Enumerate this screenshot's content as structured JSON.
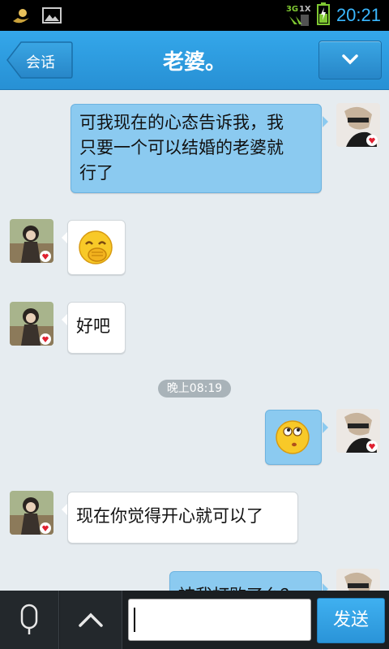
{
  "status_bar": {
    "time": "20:21",
    "network_left": "3G",
    "network_right": "1X",
    "icons": [
      "notification-app-icon",
      "image-icon",
      "signal-icon",
      "battery-charging-icon"
    ]
  },
  "header": {
    "back_label": "会话",
    "title": "老婆。",
    "menu_icon": "chevron-down-icon"
  },
  "messages": [
    {
      "direction": "outgoing",
      "type": "text",
      "lines": [
        "可我现在的心态告诉我，我",
        "只要一个可以结婚的老婆就",
        "行了"
      ]
    },
    {
      "direction": "incoming",
      "type": "emoji",
      "emoji": "shy-laugh-emoji"
    },
    {
      "direction": "incoming",
      "type": "text",
      "lines": [
        "好吧"
      ]
    },
    {
      "type": "timestamp",
      "text": "晚上08:19"
    },
    {
      "direction": "outgoing",
      "type": "emoji",
      "emoji": "thinking-emoji"
    },
    {
      "direction": "incoming",
      "type": "text",
      "lines": [
        "现在你觉得开心就可以了"
      ]
    },
    {
      "direction": "outgoing",
      "type": "text",
      "lines": [
        "被我打败了么？"
      ]
    }
  ],
  "input_bar": {
    "voice_icon": "microphone-icon",
    "expand_icon": "chevron-up-icon",
    "input_value": "",
    "send_label": "发送"
  }
}
